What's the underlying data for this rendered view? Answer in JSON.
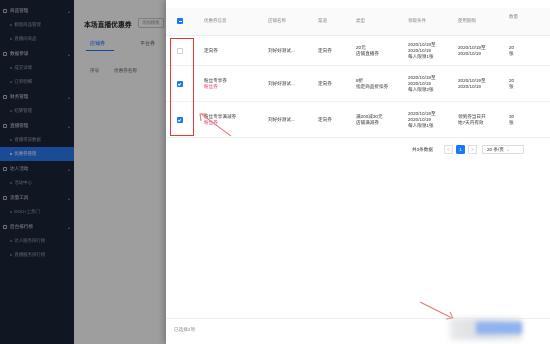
{
  "sidebar": {
    "groups": [
      {
        "label": "商品管理",
        "items": [
          "橱窗商品管理",
          "直播间商品"
        ]
      },
      {
        "label": "数据参谋",
        "items": [
          "成交详情",
          "订单明细"
        ]
      },
      {
        "label": "财务管理",
        "items": [
          "结算管理"
        ]
      },
      {
        "label": "直播管理",
        "items": [
          "直播带货数据",
          "优惠券管理"
        ]
      },
      {
        "label": "达人活动",
        "items": [
          "活动中心"
        ]
      },
      {
        "label": "流量工具",
        "items": [
          "DOU+上热门"
        ]
      },
      {
        "label": "后台排行榜",
        "items": [
          "达人服务排行榜",
          "直播服务排行榜"
        ]
      }
    ],
    "active_item": "优惠券管理"
  },
  "background_page": {
    "title": "本场直播优惠券",
    "badge": "添加模板",
    "tabs": [
      "店铺券",
      "平台券"
    ],
    "columns": [
      "序号",
      "优惠券名称"
    ]
  },
  "drawer": {
    "columns": [
      "优惠券信息",
      "店铺名称",
      "渠道",
      "类型",
      "领取条件",
      "使用期限",
      "数量"
    ],
    "rows": [
      {
        "checked": false,
        "name": "定向券",
        "tag": "",
        "shop": "刘好好测试...",
        "channel": "定向券",
        "type": [
          "20元",
          "店铺直播券"
        ],
        "condition": [
          "2020/10/19至",
          "2020/10/19",
          "每人限领1张"
        ],
        "period": [
          "2020/10/19至",
          "2020/10/19"
        ],
        "qty": [
          "20",
          "张"
        ]
      },
      {
        "checked": true,
        "name": "粉丝专享券",
        "tag": "粉丝券",
        "shop": "刘好好测试...",
        "channel": "定向券",
        "type": [
          "8折",
          "指定商品折扣券"
        ],
        "condition": [
          "2020/10/19至",
          "2020/10/19",
          "每人限领2张"
        ],
        "period": [
          "2020/10/19至",
          "2020/10/19"
        ],
        "qty": [
          "20",
          "张"
        ]
      },
      {
        "checked": true,
        "name": "粉丝专享满减券",
        "tag": "粉丝券",
        "shop": "刘好好测试...",
        "channel": "定向券",
        "type": [
          "满200减30元",
          "店铺满减券"
        ],
        "condition": [
          "2020/10/19至",
          "2020/10/19",
          "每人限领1张"
        ],
        "period": [
          "领到券当日开",
          "始7天内有效"
        ],
        "qty": [
          "30",
          "张"
        ]
      }
    ],
    "pagination": {
      "total_text": "共3条数据",
      "prev": "<",
      "current": "1",
      "next": ">",
      "page_size": "20 条/页"
    },
    "footer": {
      "selected_text": "已选择2项"
    }
  },
  "colors": {
    "accent": "#1677ff",
    "annotation": "#e53935",
    "sidebar_bg": "#1b2438"
  }
}
